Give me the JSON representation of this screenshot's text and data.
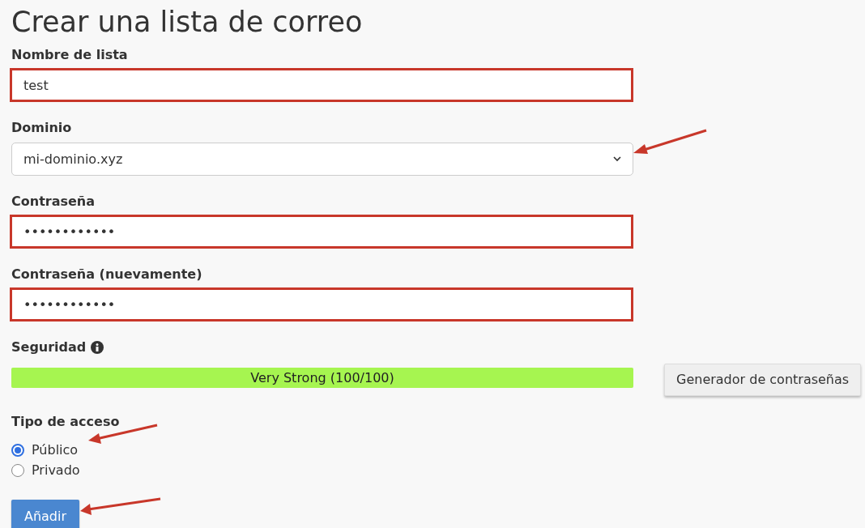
{
  "title": "Crear una lista de correo",
  "fields": [
    {
      "kind": "text",
      "label": "Nombre de lista",
      "value": "test",
      "highlighted": true
    },
    {
      "kind": "select",
      "label": "Dominio",
      "value": "mi-dominio.xyz",
      "highlighted": false
    },
    {
      "kind": "password",
      "label": "Contraseña",
      "value": "••••••••••••",
      "highlighted": true
    },
    {
      "kind": "password",
      "label": "Contraseña (nuevamente)",
      "value": "••••••••••••",
      "highlighted": true
    }
  ],
  "security": {
    "label": "Seguridad",
    "level": 1,
    "reading": "Very Strong (100/100)",
    "generator_button": "Generador de contraseñas"
  },
  "access": {
    "label": "Tipo de acceso",
    "options": [
      {
        "label": "Público",
        "selected": true
      },
      {
        "label": "Privado",
        "selected": false
      }
    ]
  },
  "submit_button": "Añadir"
}
